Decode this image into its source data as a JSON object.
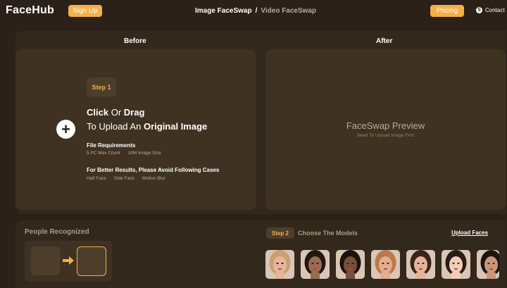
{
  "header": {
    "logo": "FaceHub",
    "signup_label": "Sign Up",
    "nav_active": "Image FaceSwap",
    "nav_separator": "/",
    "nav_inactive": "Video FaceSwap",
    "pricing_label": "Pricing",
    "contact_label": "Contact",
    "contact_icon": "skype-icon"
  },
  "before": {
    "heading": "Before",
    "step_label": "Step 1",
    "upload_click": "Click",
    "upload_or": "Or",
    "upload_drag": "Drag",
    "upload_line2_prefix": "To Upload An",
    "upload_line2_bold": "Original Image",
    "file_req_title": "File Requirements",
    "file_req_items": [
      "5 PC Max Count",
      "10M Image Size"
    ],
    "avoid_title": "For Better Results, Please Avoid Following Cases",
    "avoid_items": [
      "Half Face",
      "Side Face",
      "Motion Blur"
    ]
  },
  "after": {
    "heading": "After",
    "preview_title": "FaceSwap Preview",
    "preview_sub": "Need To Upload Image First"
  },
  "people": {
    "title": "People Recognized"
  },
  "models": {
    "step_label": "Step 2",
    "title": "Choose The Models",
    "upload_link": "Upload Faces",
    "thumbnails": [
      {
        "name": "model-1",
        "skin": "#e8b59c",
        "hair": "#c9a070"
      },
      {
        "name": "model-2",
        "skin": "#9a6a52",
        "hair": "#1f1712"
      },
      {
        "name": "model-3",
        "skin": "#7a4e3a",
        "hair": "#1a120e"
      },
      {
        "name": "model-4",
        "skin": "#e3ad8c",
        "hair": "#b87a4a"
      },
      {
        "name": "model-5",
        "skin": "#e6b49c",
        "hair": "#3a2418"
      },
      {
        "name": "model-6",
        "skin": "#f0cdb6",
        "hair": "#2a1d16"
      },
      {
        "name": "model-7",
        "skin": "#c99778",
        "hair": "#1c1410"
      }
    ]
  },
  "colors": {
    "background": "#2b2118",
    "panel": "#33281c",
    "card": "#3f3222",
    "accent": "#f4b04a"
  }
}
